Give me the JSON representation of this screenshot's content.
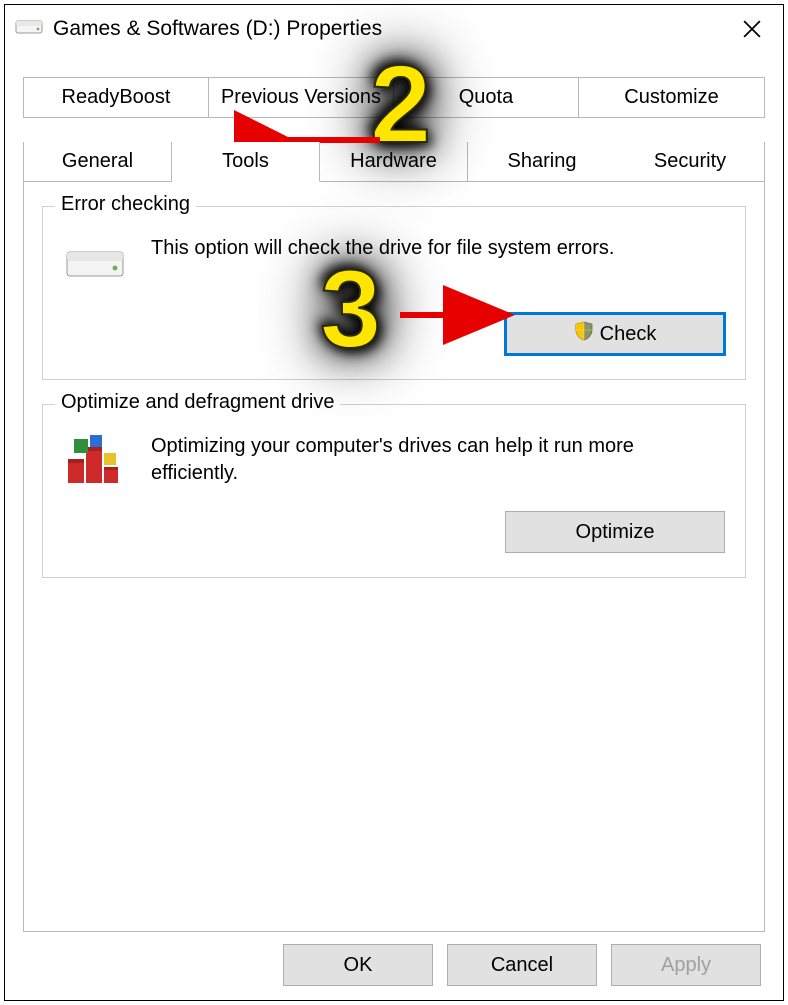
{
  "window": {
    "title": "Games & Softwares (D:) Properties"
  },
  "tabs": {
    "row1": [
      "ReadyBoost",
      "Previous Versions",
      "Quota",
      "Customize"
    ],
    "row2": [
      "General",
      "Tools",
      "Hardware",
      "Sharing",
      "Security"
    ],
    "active": "Tools"
  },
  "error_checking": {
    "legend": "Error checking",
    "description": "This option will check the drive for file system errors.",
    "button": "Check"
  },
  "optimize": {
    "legend": "Optimize and defragment drive",
    "description": "Optimizing your computer's drives can help it run more efficiently.",
    "button": "Optimize"
  },
  "buttons": {
    "ok": "OK",
    "cancel": "Cancel",
    "apply": "Apply"
  },
  "annotations": {
    "step2": "2",
    "step3": "3"
  }
}
